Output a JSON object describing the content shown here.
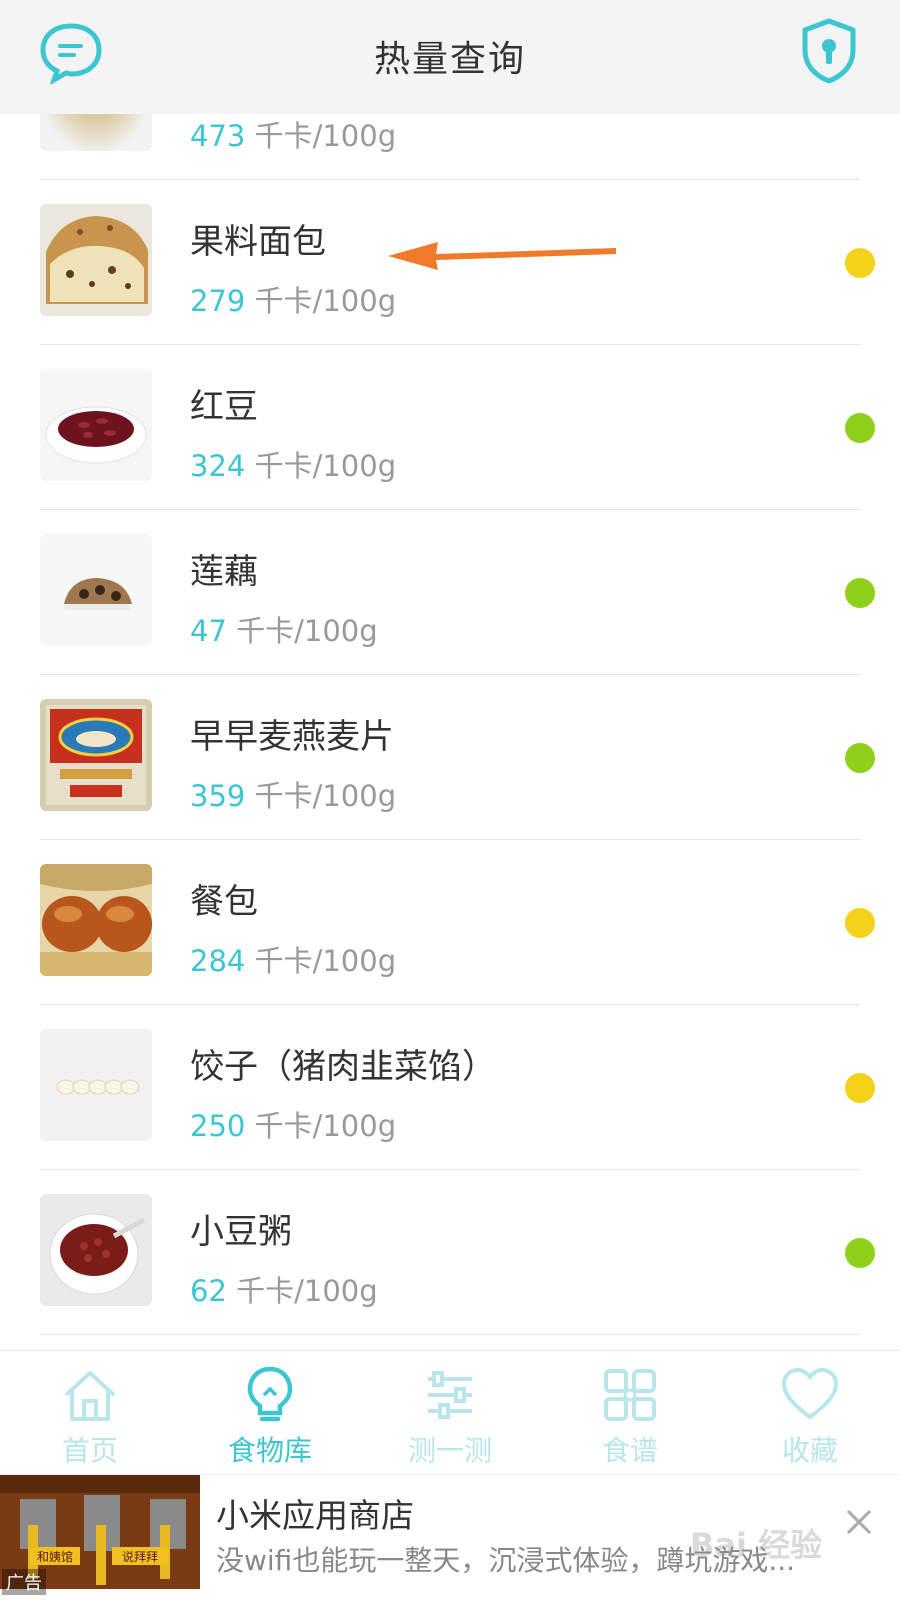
{
  "header": {
    "title": "热量查询"
  },
  "items": [
    {
      "name": "",
      "calories": "473",
      "unit": "千卡/100g",
      "dot_color": "#f2c200"
    },
    {
      "name": "果料面包",
      "calories": "279",
      "unit": "千卡/100g",
      "dot_color": "#f5d21a"
    },
    {
      "name": "红豆",
      "calories": "324",
      "unit": "千卡/100g",
      "dot_color": "#8fd11a"
    },
    {
      "name": "莲藕",
      "calories": "47",
      "unit": "千卡/100g",
      "dot_color": "#8fd11a"
    },
    {
      "name": "早早麦燕麦片",
      "calories": "359",
      "unit": "千卡/100g",
      "dot_color": "#8fd11a"
    },
    {
      "name": "餐包",
      "calories": "284",
      "unit": "千卡/100g",
      "dot_color": "#f5d21a"
    },
    {
      "name": "饺子（猪肉韭菜馅）",
      "calories": "250",
      "unit": "千卡/100g",
      "dot_color": "#f5d21a"
    },
    {
      "name": "小豆粥",
      "calories": "62",
      "unit": "千卡/100g",
      "dot_color": "#8fd11a"
    }
  ],
  "tabbar": {
    "tabs": [
      {
        "label": "首页",
        "icon": "home-icon"
      },
      {
        "label": "食物库",
        "icon": "lightbulb-icon"
      },
      {
        "label": "测一测",
        "icon": "sliders-icon"
      },
      {
        "label": "食谱",
        "icon": "grid-icon"
      },
      {
        "label": "收藏",
        "icon": "heart-icon"
      }
    ],
    "active_index": 1
  },
  "ad": {
    "title": "小米应用商店",
    "description": "没wifi也能玩一整天，沉浸式体验，蹲坑游戏...",
    "tag": "广告",
    "image_texts": [
      "和姨馆",
      "说拜拜"
    ]
  },
  "watermark": "Bai 经验",
  "colors": {
    "accent": "#3cc6d2",
    "arrow": "#f07a2a",
    "inactive_tab": "#b8e6ea"
  }
}
